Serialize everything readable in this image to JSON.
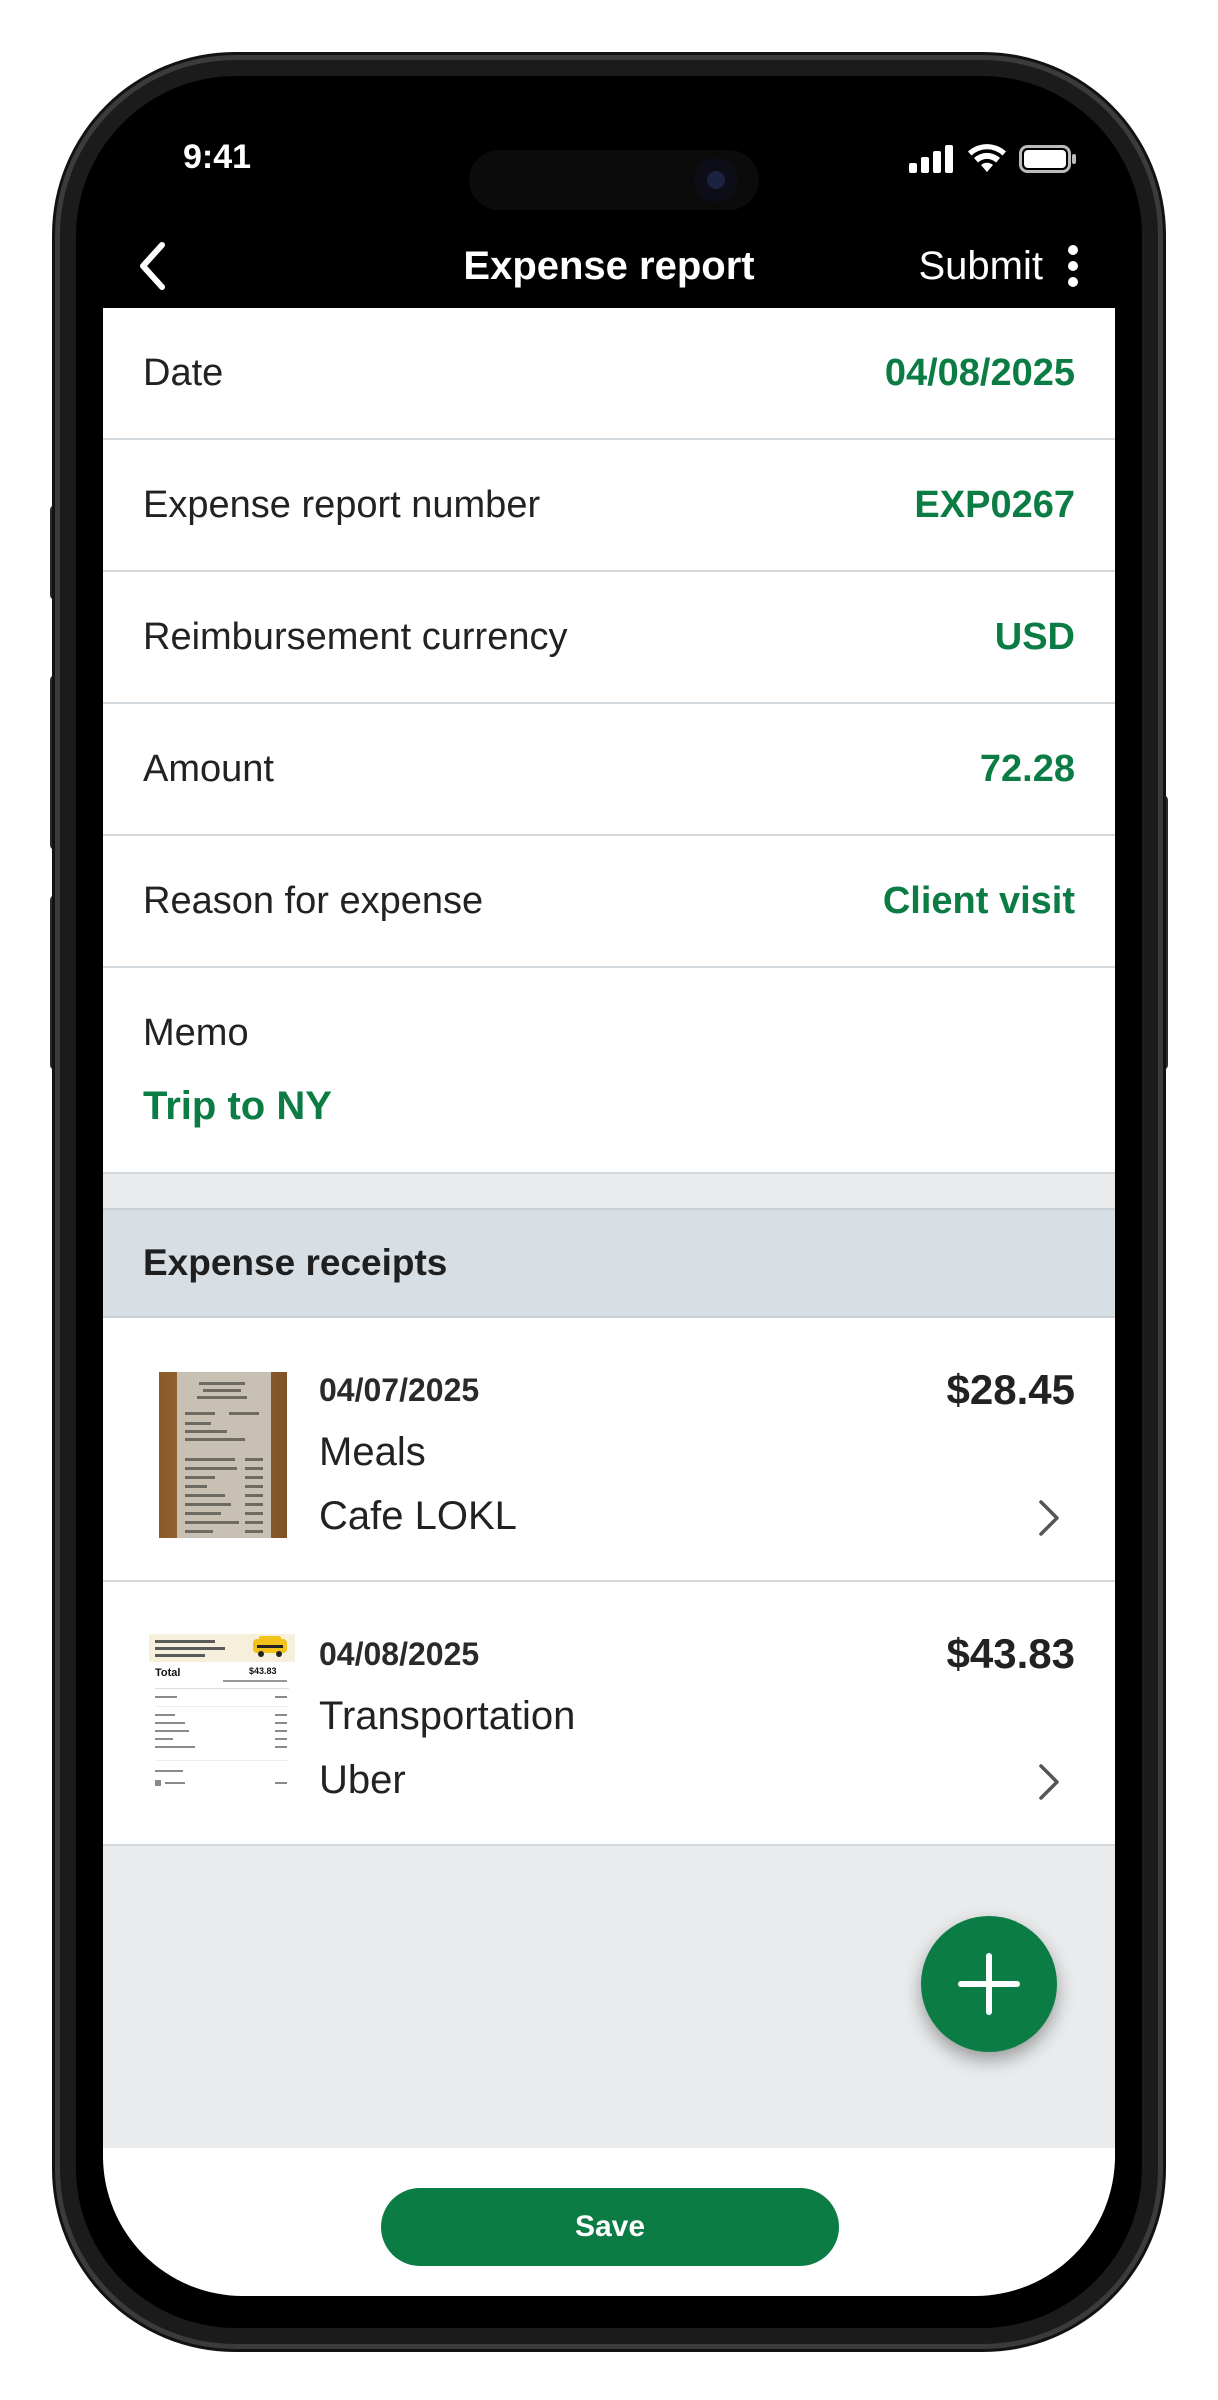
{
  "status_bar": {
    "time": "9:41",
    "icons": [
      "cellular-signal-icon",
      "wifi-icon",
      "battery-icon"
    ]
  },
  "nav": {
    "back_icon": "chevron-left-icon",
    "title": "Expense report",
    "submit_label": "Submit",
    "more_icon": "vertical-ellipsis-icon"
  },
  "fields": {
    "date": {
      "label": "Date",
      "value": "04/08/2025"
    },
    "report_number": {
      "label": "Expense report number",
      "value": "EXP0267"
    },
    "currency": {
      "label": "Reimbursement currency",
      "value": "USD"
    },
    "amount": {
      "label": "Amount",
      "value": "72.28"
    },
    "reason": {
      "label": "Reason for expense",
      "value": "Client visit"
    },
    "memo": {
      "label": "Memo",
      "value": "Trip to NY"
    }
  },
  "receipts_section": {
    "title": "Expense receipts",
    "items": [
      {
        "date": "04/07/2025",
        "category": "Meals",
        "merchant": "Cafe LOKL",
        "amount": "$28.45",
        "thumbnail": "paper-receipt-photo"
      },
      {
        "date": "04/08/2025",
        "category": "Transportation",
        "merchant": "Uber",
        "amount": "$43.83",
        "thumbnail": "uber-receipt-screenshot"
      }
    ]
  },
  "fab": {
    "icon": "plus-icon"
  },
  "footer": {
    "save_label": "Save"
  },
  "colors": {
    "accent_green": "#0b7d44",
    "header_black": "#000000",
    "section_header_bg": "#d8dfe4",
    "content_bg": "#e9ebed"
  }
}
